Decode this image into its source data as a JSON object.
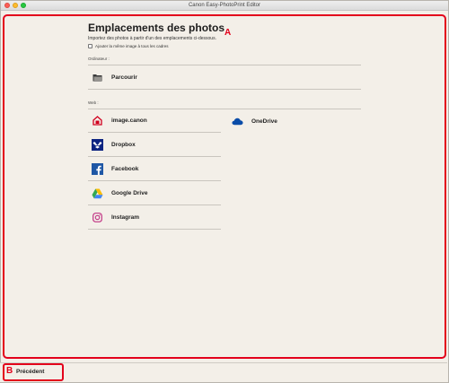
{
  "window": {
    "title": "Canon Easy-PhotoPrint Editor"
  },
  "page": {
    "title": "Emplacements des photos",
    "subtitle": "Importez des photos à partir d'un des emplacements ci-dessous.",
    "checkbox_label": "Ajouter la même image à tous les cadres"
  },
  "sections": {
    "computer": {
      "label": "Ordinateur :",
      "items": [
        {
          "label": "Parcourir",
          "icon": "folder-icon"
        }
      ]
    },
    "web": {
      "label": "Web :",
      "left_items": [
        {
          "label": "image.canon",
          "icon": "image-canon-icon",
          "color": "#d1001f"
        },
        {
          "label": "Dropbox",
          "icon": "dropbox-icon",
          "color": "#0d2481"
        },
        {
          "label": "Facebook",
          "icon": "facebook-icon",
          "color": "#1f57a5"
        },
        {
          "label": "Google Drive",
          "icon": "google-drive-icon",
          "color": "#34a853"
        },
        {
          "label": "Instagram",
          "icon": "instagram-icon",
          "color": "#c13584"
        }
      ],
      "right_items": [
        {
          "label": "OneDrive",
          "icon": "onedrive-icon",
          "color": "#0a4ca8"
        }
      ]
    }
  },
  "annotations": {
    "a": "A",
    "b": "B"
  },
  "footer": {
    "back_label": "Précédent"
  }
}
